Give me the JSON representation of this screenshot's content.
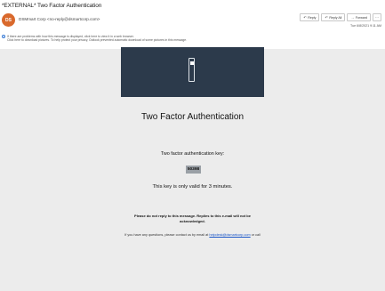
{
  "email": {
    "subject": "*EXTERNAL* Two Factor Authentication",
    "avatar_initials": "DS",
    "avatar_color": "#d9692c",
    "sender": "DSMmart Corp <no-reply@dsmartcorp.com>",
    "datetime": "Tue 6/8/2021 9:11 AM",
    "notice_line1": "If there are problems with how this message is displayed, click here to view it in a web browser.",
    "notice_line2": "Click here to download pictures. To help protect your privacy, Outlook prevented automatic download of some pictures in this message."
  },
  "actions": [
    {
      "icon": "reply-icon",
      "glyph": "↶",
      "label": "Reply"
    },
    {
      "icon": "reply-all-icon",
      "glyph": "↶",
      "label": "Reply All"
    },
    {
      "icon": "forward-icon",
      "glyph": "→",
      "label": "Forward"
    }
  ],
  "message": {
    "banner_color": "#2c3a4b",
    "title": "Two Factor Authentication",
    "key_label": "Two factor authentication key:",
    "key_value": "50398",
    "validity": "This key is only valid for 3 minutes.",
    "noreply": "Please do not reply to this message. Replies to this e-mail will not be acknowledged.",
    "contact_prefix": "If you have any questions, please contact us by email at ",
    "contact_email": "helpdesk@dsmartcorp.com",
    "contact_suffix": " or call"
  }
}
